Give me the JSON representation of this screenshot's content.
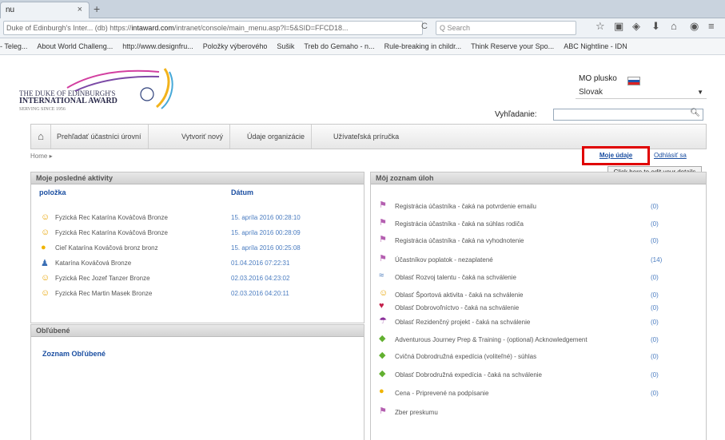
{
  "browser": {
    "tab_title": "nu",
    "tab_close": "×",
    "new_tab": "+",
    "url_prefix": "Duke of Edinburgh's Inter... (db) https://",
    "url_host": "intaward.com",
    "url_path": "/intranet/console/main_menu.asp?l=5&SID=FFCD18...",
    "reload": "C",
    "search_placeholder": "Q Search",
    "bookmarks": [
      "- Teleg...",
      "About World Challeng...",
      "http://www.designfru...",
      "Položky výberového",
      "Sušik",
      "Treb do Gemaho - n...",
      "Rule-breaking in childr...",
      "Think Reserve your Spo...",
      "ABC Nightline - IDN"
    ]
  },
  "header": {
    "logo_line1": "THE DUKE OF EDINBURGH'S",
    "logo_line2": "INTERNATIONAL AWARD",
    "logo_line3": "SERVING SINCE 1956",
    "lang_label": "MO plusko",
    "lang_value": "Slovak",
    "search_label": "Vyhľadanie:"
  },
  "menu": {
    "items": [
      "Prehľadať účastníci úrovní",
      "Vytvoriť nový",
      "Údaje organizácie",
      "Užívateľská príručka"
    ]
  },
  "breadcrumb": "Home ▸",
  "user_links": {
    "edit": "Moje údaje",
    "logout": "Odhlásiť sa",
    "tooltip": "Click here to edit your details"
  },
  "recent": {
    "title": "Moje posledné aktivity",
    "col_action": "položka",
    "col_date": "Dátum",
    "rows": [
      {
        "icon": "☺",
        "text": "Fyzická Rec Katarína Kováčová Bronze",
        "date": "15. apríla 2016 00:28:10"
      },
      {
        "icon": "☺",
        "text": "Fyzická Rec Katarína Kováčová Bronze",
        "date": "15. apríla 2016 00:28:09"
      },
      {
        "icon": "●",
        "text": "Cieľ Katarína Kováčová bronz bronz",
        "date": "15. apríla 2016 00:25:08"
      },
      {
        "icon": "♟",
        "text": "Katarína Kováčová Bronze",
        "date": "01.04.2016 07:22:31"
      },
      {
        "icon": "☺",
        "text": "Fyzická Rec Jozef Tanzer Bronze",
        "date": "02.03.2016 04:23:02"
      },
      {
        "icon": "☺",
        "text": "Fyzická Rec Martin Masek Bronze",
        "date": "02.03.2016 04:20:11"
      }
    ]
  },
  "favorites": {
    "title": "Obľúbené",
    "link": "Zoznam Obľúbené"
  },
  "tasks": {
    "title": "Môj zoznam úloh",
    "rows": [
      {
        "icon": "⚑",
        "text": "Registrácia účastníka - čaká na potvrdenie emailu",
        "count": "(0)"
      },
      {
        "icon": "⚑",
        "text": "Registrácia účastníka - čaká na súhlas rodiča",
        "count": "(0)"
      },
      {
        "icon": "⚑",
        "text": "Registrácia účastníka - čaká na vyhodnotenie",
        "count": "(0)"
      },
      {
        "icon": "⚑",
        "text": "Účastníkov poplatok - nezaplatené",
        "count": "(14)"
      },
      {
        "icon": "≈",
        "text": "Oblasť Rozvoj talentu - čaká na schválenie",
        "count": "(0)"
      },
      {
        "icon": "☺",
        "text": "Oblasť Športová aktivita - čaká na schválenie",
        "count": "(0)"
      },
      {
        "icon": "♥",
        "text": "Oblasť Dobrovoľníctvo - čaká na schválenie",
        "count": "(0)"
      },
      {
        "icon": "☂",
        "text": "Oblasť Rezidenčný projekt - čaká na schválenie",
        "count": "(0)"
      },
      {
        "icon": "◆",
        "text": "Adventurous Journey Prep & Training - (optional) Acknowledgement",
        "count": "(0)"
      },
      {
        "icon": "◆",
        "text": "Cvičná Dobrodružná expedícia (voliteľné) - súhlas",
        "count": "(0)"
      },
      {
        "icon": "◆",
        "text": "Oblasť Dobrodružná expedícia - čaká na schválenie",
        "count": "(0)"
      },
      {
        "icon": "●",
        "text": "Cena - Priprevené na podpísanie",
        "count": "(0)"
      },
      {
        "icon": "⚑",
        "text": "Zber preskumu",
        "count": ""
      }
    ]
  },
  "colors": {
    "link": "#1a4ea1",
    "highlight": "#e00000"
  }
}
